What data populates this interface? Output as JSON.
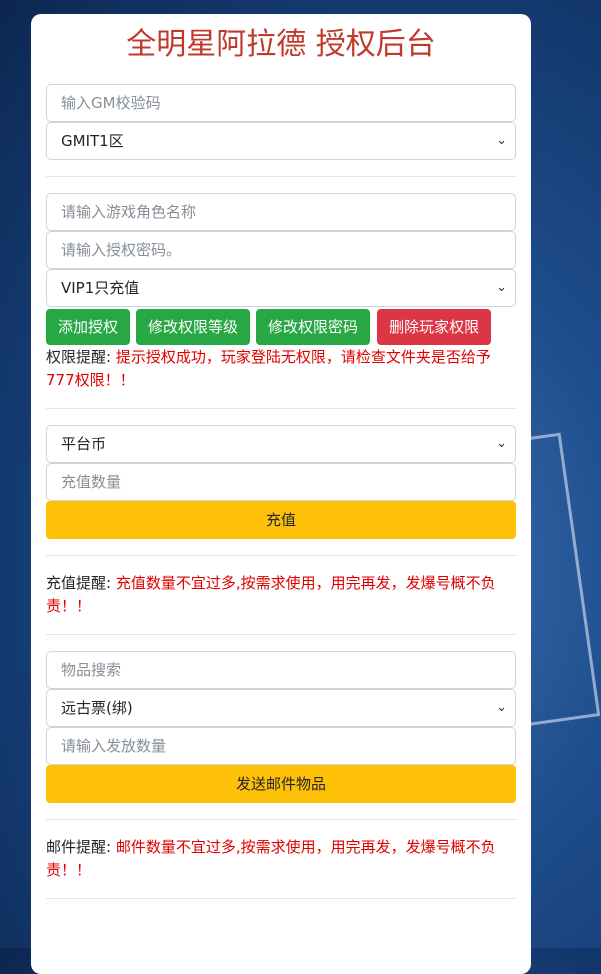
{
  "title": "全明星阿拉德 授权后台",
  "gm": {
    "code_placeholder": "输入GM校验码",
    "server_selected": "GMIT1区"
  },
  "auth": {
    "role_placeholder": "请输入游戏角色名称",
    "password_placeholder": "请输入授权密码。",
    "vip_selected": "VIP1只充值",
    "add_label": "添加授权",
    "modify_level_label": "修改权限等级",
    "modify_password_label": "修改权限密码",
    "delete_label": "删除玩家权限",
    "notice_label": "权限提醒:",
    "notice_text": "提示授权成功，玩家登陆无权限，请检查文件夹是否给予777权限！！"
  },
  "recharge": {
    "currency_selected": "平台币",
    "amount_placeholder": "充值数量",
    "submit_label": "充值",
    "notice_label": "充值提醒:",
    "notice_text": "充值数量不宜过多,按需求使用，用完再发，发爆号概不负责！！"
  },
  "mail": {
    "search_placeholder": "物品搜索",
    "item_selected": "远古票(绑)",
    "quantity_placeholder": "请输入发放数量",
    "submit_label": "发送邮件物品",
    "notice_label": "邮件提醒:",
    "notice_text": "邮件数量不宜过多,按需求使用，用完再发，发爆号概不负责！！"
  },
  "icons": {
    "select_arrow": "chevron-down-icon"
  },
  "colors": {
    "title": "#c0392b",
    "green": "#28a745",
    "red": "#dc3545",
    "yellow": "#ffc107",
    "warning_text": "#e00000"
  }
}
